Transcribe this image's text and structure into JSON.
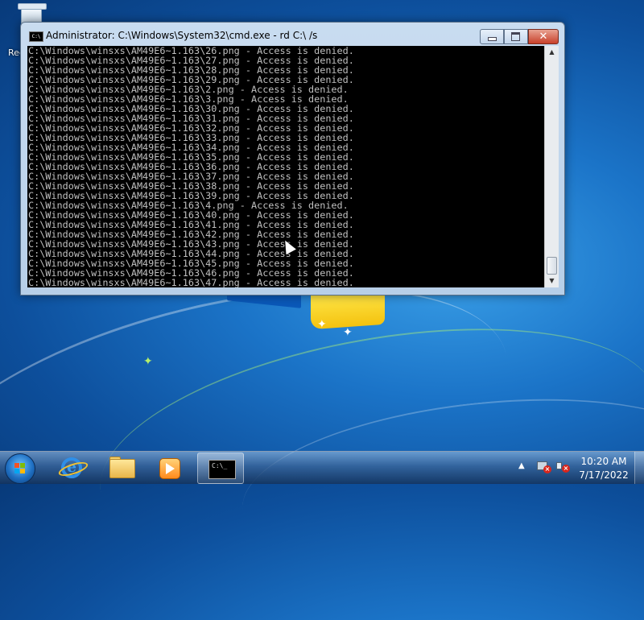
{
  "desktop": {
    "recycle_bin_label": "Rec"
  },
  "window": {
    "title": "Administrator: C:\\Windows\\System32\\cmd.exe - rd  C:\\ /s",
    "icon_text": "C:\\",
    "buttons": {
      "minimize": "minimize-icon",
      "maximize": "maximize-icon",
      "close_glyph": "✕"
    }
  },
  "console": {
    "lines": [
      "C:\\Windows\\winsxs\\AM49E6~1.163\\26.png - Access is denied.",
      "C:\\Windows\\winsxs\\AM49E6~1.163\\27.png - Access is denied.",
      "C:\\Windows\\winsxs\\AM49E6~1.163\\28.png - Access is denied.",
      "C:\\Windows\\winsxs\\AM49E6~1.163\\29.png - Access is denied.",
      "C:\\Windows\\winsxs\\AM49E6~1.163\\2.png - Access is denied.",
      "C:\\Windows\\winsxs\\AM49E6~1.163\\3.png - Access is denied.",
      "C:\\Windows\\winsxs\\AM49E6~1.163\\30.png - Access is denied.",
      "C:\\Windows\\winsxs\\AM49E6~1.163\\31.png - Access is denied.",
      "C:\\Windows\\winsxs\\AM49E6~1.163\\32.png - Access is denied.",
      "C:\\Windows\\winsxs\\AM49E6~1.163\\33.png - Access is denied.",
      "C:\\Windows\\winsxs\\AM49E6~1.163\\34.png - Access is denied.",
      "C:\\Windows\\winsxs\\AM49E6~1.163\\35.png - Access is denied.",
      "C:\\Windows\\winsxs\\AM49E6~1.163\\36.png - Access is denied.",
      "C:\\Windows\\winsxs\\AM49E6~1.163\\37.png - Access is denied.",
      "C:\\Windows\\winsxs\\AM49E6~1.163\\38.png - Access is denied.",
      "C:\\Windows\\winsxs\\AM49E6~1.163\\39.png - Access is denied.",
      "C:\\Windows\\winsxs\\AM49E6~1.163\\4.png - Access is denied.",
      "C:\\Windows\\winsxs\\AM49E6~1.163\\40.png - Access is denied.",
      "C:\\Windows\\winsxs\\AM49E6~1.163\\41.png - Access is denied.",
      "C:\\Windows\\winsxs\\AM49E6~1.163\\42.png - Access is denied.",
      "C:\\Windows\\winsxs\\AM49E6~1.163\\43.png - Access is denied.",
      "C:\\Windows\\winsxs\\AM49E6~1.163\\44.png - Access is denied.",
      "C:\\Windows\\winsxs\\AM49E6~1.163\\45.png - Access is denied.",
      "C:\\Windows\\winsxs\\AM49E6~1.163\\46.png - Access is denied.",
      "C:\\Windows\\winsxs\\AM49E6~1.163\\47.png - Access is denied."
    ],
    "text_color": "#c0c0c0",
    "background": "#000000"
  },
  "taskbar": {
    "items": [
      {
        "name": "start-orb",
        "icon": "windows-logo-icon"
      },
      {
        "name": "internet-explorer",
        "icon": "ie-icon"
      },
      {
        "name": "windows-explorer",
        "icon": "folder-icon"
      },
      {
        "name": "media-player",
        "icon": "media-player-icon"
      },
      {
        "name": "command-prompt",
        "icon": "cmd-icon",
        "icon_text": "C:\\_",
        "active": true
      }
    ],
    "tray": {
      "overflow_arrow": "▲",
      "network_icon": "network-error-icon",
      "volume_icon": "volume-muted-icon"
    },
    "clock": {
      "time": "10:20 AM",
      "date": "7/17/2022"
    }
  }
}
